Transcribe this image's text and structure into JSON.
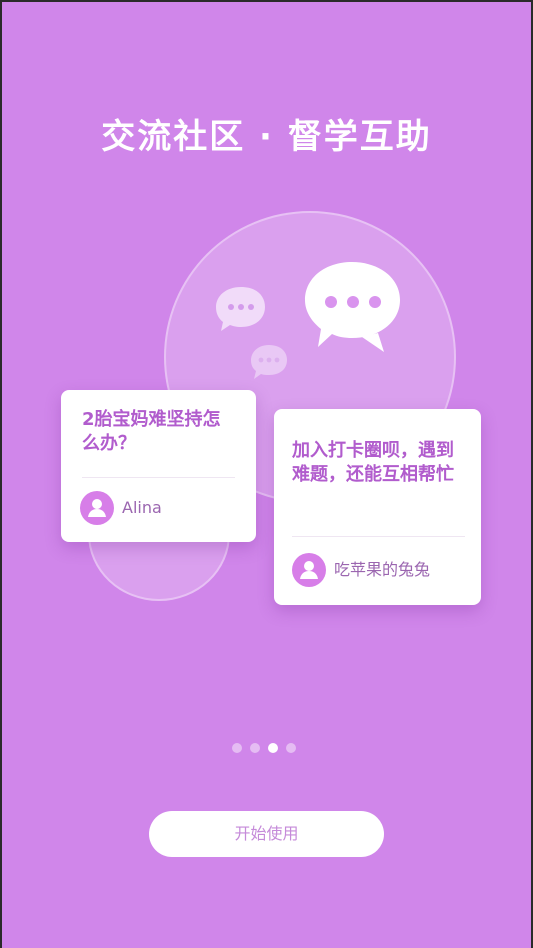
{
  "header": {
    "title": "交流社区 · 督学互助"
  },
  "cards": [
    {
      "text": "2胎宝妈难坚持怎么办？",
      "user": "Alina"
    },
    {
      "text": "加入打卡圈呗，遇到难题，还能互相帮忙",
      "user": "吃苹果的兔兔"
    }
  ],
  "pager": {
    "count": 4,
    "active_index": 2
  },
  "actions": {
    "start_label": "开始使用"
  },
  "colors": {
    "background": "#d086ea",
    "accent_text": "#b15ccd",
    "avatar": "#d77ee8",
    "button_text": "#c58ad9"
  },
  "icons": {
    "chat_bubble": "chat-bubble-icon",
    "avatar": "user-avatar-icon"
  }
}
